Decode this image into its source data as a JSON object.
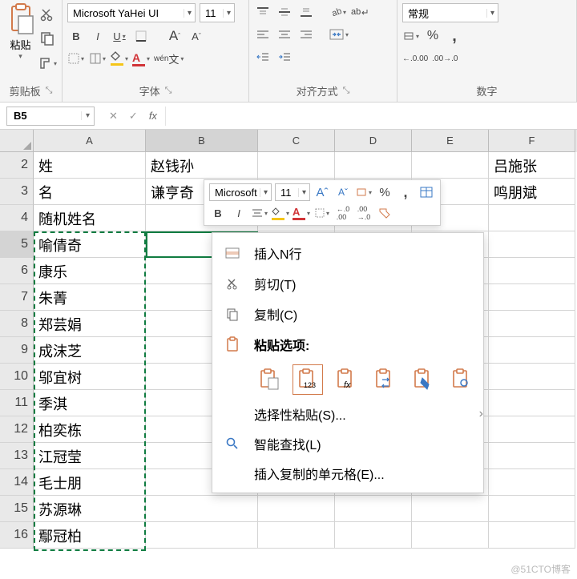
{
  "ribbon": {
    "clipboard": {
      "label": "剪贴板",
      "paste": "粘贴"
    },
    "font": {
      "label": "字体",
      "name": "Microsoft YaHei UI",
      "size": "11",
      "bold": "B",
      "italic": "I",
      "underline": "U",
      "grow": "A",
      "shrink": "A",
      "wen": "wén",
      "wen2": "文"
    },
    "align": {
      "label": "对齐方式",
      "wrap": "ab"
    },
    "number": {
      "label": "数字",
      "format": "常规",
      "pct": "%",
      "comma": ",",
      "inc": ".00",
      "dec": ".00"
    }
  },
  "formula": {
    "ref": "B5",
    "cancel": "✕",
    "confirm": "✓",
    "fx": "fx"
  },
  "columns": [
    "A",
    "B",
    "C",
    "D",
    "E",
    "F"
  ],
  "rows": [
    {
      "n": 2,
      "A": "姓",
      "B": "赵钱孙",
      "F": "吕施张"
    },
    {
      "n": 3,
      "A": "名",
      "B": "谦亨奇",
      "F": "鸣朋斌"
    },
    {
      "n": 4,
      "A": "随机姓名"
    },
    {
      "n": 5,
      "A": "喻倩奇"
    },
    {
      "n": 6,
      "A": "康乐"
    },
    {
      "n": 7,
      "A": "朱菁"
    },
    {
      "n": 8,
      "A": "郑芸娟"
    },
    {
      "n": 9,
      "A": "成沫芝"
    },
    {
      "n": 10,
      "A": "邬宜树"
    },
    {
      "n": 11,
      "A": "季淇"
    },
    {
      "n": 12,
      "A": "柏奕栋"
    },
    {
      "n": 13,
      "A": "江冠莹"
    },
    {
      "n": 14,
      "A": "毛士朋"
    },
    {
      "n": 15,
      "A": "苏源琳"
    },
    {
      "n": 16,
      "A": "鄢冠柏"
    }
  ],
  "mini": {
    "font": "Microsoft",
    "size": "11",
    "grow": "A",
    "shrink": "A",
    "pct": "%",
    "comma": ",",
    "bold": "B",
    "italic": "I"
  },
  "ctx": {
    "insertN": "插入N行",
    "cut": "剪切(T)",
    "copy": "复制(C)",
    "pasteOpts": "粘贴选项:",
    "values": "123",
    "fx": "fx",
    "pasteSpecial": "选择性粘贴(S)...",
    "smartFind": "智能查找(L)",
    "insertCopied": "插入复制的单元格(E)..."
  },
  "watermark": "@51CTO博客"
}
